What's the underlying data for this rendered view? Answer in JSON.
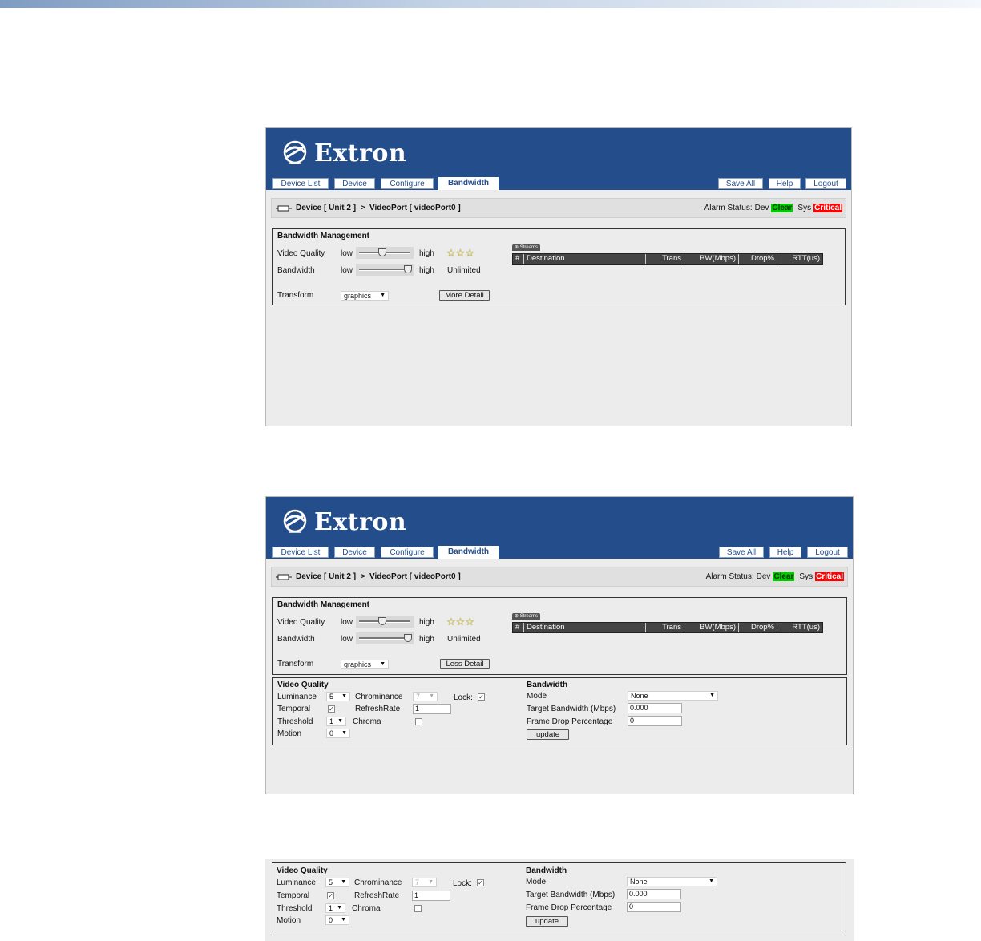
{
  "app": {
    "brand": "Extron",
    "colors": {
      "header": "#244d8c",
      "clear": "#00cc00",
      "critical": "#ff0000"
    }
  },
  "tabs": {
    "left": [
      "Device List",
      "Device",
      "Configure",
      "Bandwidth"
    ],
    "active": "Bandwidth",
    "right": [
      "Save All",
      "Help",
      "Logout"
    ]
  },
  "breadcrumb": {
    "text": "Device [ Unit 2 ]  >  VideoPort [ videoPort0 ]"
  },
  "alarm": {
    "label": "Alarm Status:",
    "dev_label": "Dev",
    "dev_status": "Clear",
    "sys_label": "Sys",
    "sys_status": "Critical"
  },
  "bw_mgmt": {
    "title": "Bandwidth Management",
    "video_quality_label": "Video Quality",
    "bandwidth_label": "Bandwidth",
    "low": "low",
    "high": "high",
    "video_quality_level": 0.45,
    "bandwidth_level": 1.0,
    "stars": 3,
    "bandwidth_value": "Unlimited",
    "transform_label": "Transform",
    "transform_value": "graphics",
    "more_detail": "More Detail",
    "less_detail": "Less Detail"
  },
  "streams": {
    "tab_label": "Streams",
    "columns": [
      "#",
      "Destination",
      "Trans",
      "BW(Mbps)",
      "Drop%",
      "RTT(us)"
    ]
  },
  "detail": {
    "vq_title": "Video Quality",
    "luminance_label": "Luminance",
    "luminance_value": "5",
    "chrominance_label": "Chrominance",
    "chrominance_value": "7",
    "lock_label": "Lock:",
    "temporal_label": "Temporal",
    "refresh_label": "RefreshRate",
    "refresh_value": "1",
    "threshold_label": "Threshold",
    "threshold_value": "1",
    "chroma_label": "Chroma",
    "motion_label": "Motion",
    "motion_value": "0",
    "bw_title": "Bandwidth",
    "mode_label": "Mode",
    "mode_value": "None",
    "target_label": "Target Bandwidth (Mbps)",
    "target_value": "0.000",
    "frame_drop_label": "Frame Drop Percentage",
    "frame_drop_value": "0",
    "update": "update"
  }
}
